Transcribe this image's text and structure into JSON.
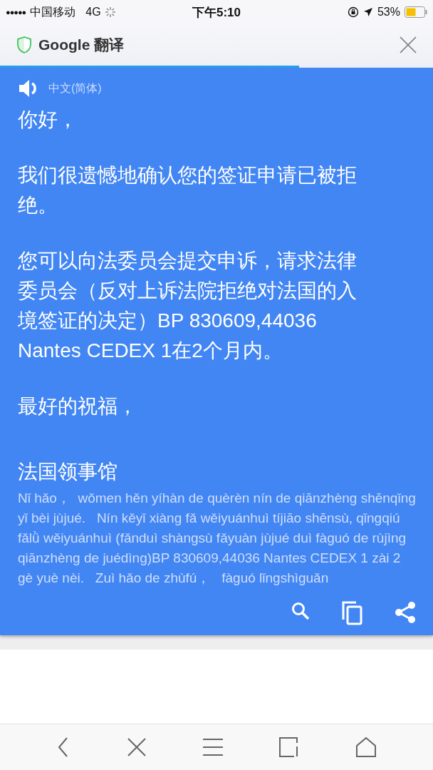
{
  "status_bar": {
    "signal_dots": "●●●●●",
    "carrier": "中国移动",
    "network": "4G",
    "time": "下午5:10",
    "battery_percent": "53%"
  },
  "header": {
    "title": "Google 翻译",
    "progress": {
      "level": 0.69
    }
  },
  "translation": {
    "source_language": "中文(简体)",
    "paragraphs": [
      "你好，",
      "我们很遗憾地确认您的签证申请已被拒绝。",
      "您可以向法委员会提交申诉，请求法律委员会（反对上诉法院拒绝对法国的入境签证的决定）BP 830609,44036 Nantes CEDEX 1在2个月内。",
      "最好的祝福，"
    ],
    "signature": "法国领事馆",
    "romanization": "Nǐ hǎo，  wǒmen hěn yíhàn de quèrèn nín de qiānzhèng shēnqǐng yǐ bèi jùjué.   Nín kěyǐ xiàng fǎ wěiyuánhuì tíjiāo shēnsù, qǐngqiú fǎlǜ wěiyuánhuì (fǎnduì shàngsù fǎyuàn jùjué duì fàguó de rùjìng qiānzhèng de juédìng)BP 830609,44036 Nantes CEDEX 1 zài 2 gè yuè nèi.   Zuì hǎo de zhùfú，   fàguó lǐngshìguǎn"
  }
}
